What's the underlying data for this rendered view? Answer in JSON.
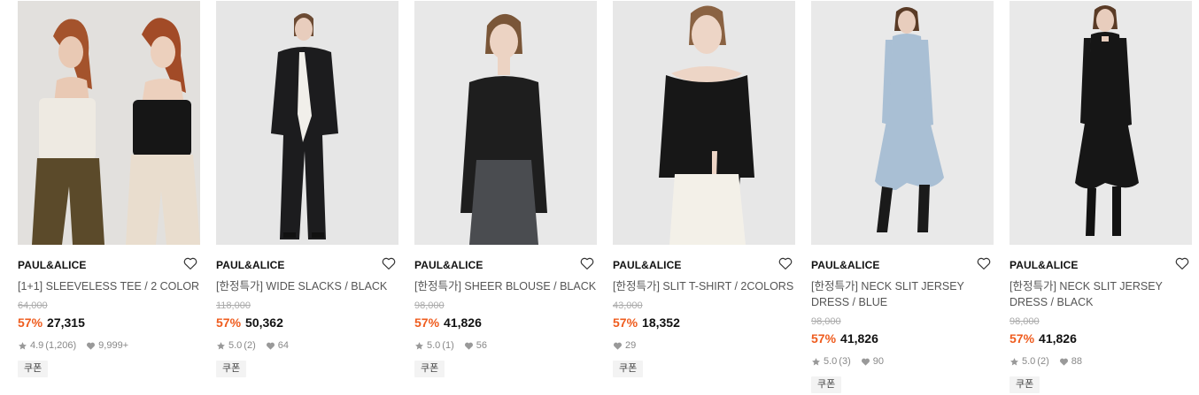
{
  "products": [
    {
      "brand": "PAUL&ALICE",
      "name": "[1+1] SLEEVELESS TEE / 2 COLOR",
      "original_price": "64,000",
      "discount": "57%",
      "price": "27,315",
      "rating": "4.9",
      "reviews": "(1,206)",
      "likes": "9,999+",
      "coupon": "쿠폰",
      "photo": "two-models-sleeveless-tees"
    },
    {
      "brand": "PAUL&ALICE",
      "name": "[한정특가] WIDE SLACKS / BLACK",
      "original_price": "118,000",
      "discount": "57%",
      "price": "50,362",
      "rating": "5.0",
      "reviews": "(2)",
      "likes": "64",
      "coupon": "쿠폰",
      "photo": "model-black-suit"
    },
    {
      "brand": "PAUL&ALICE",
      "name": "[한정특가] SHEER BLOUSE / BLACK",
      "original_price": "98,000",
      "discount": "57%",
      "price": "41,826",
      "rating": "5.0",
      "reviews": "(1)",
      "likes": "56",
      "coupon": "쿠폰",
      "photo": "model-black-blouse"
    },
    {
      "brand": "PAUL&ALICE",
      "name": "[한정특가] SLIT T-SHIRT / 2COLORS",
      "original_price": "43,000",
      "discount": "57%",
      "price": "18,352",
      "likes": "29",
      "coupon": "쿠폰",
      "photo": "model-black-slit-top"
    },
    {
      "brand": "PAUL&ALICE",
      "name": "[한정특가] NECK SLIT JERSEY DRESS / BLUE",
      "original_price": "98,000",
      "discount": "57%",
      "price": "41,826",
      "rating": "5.0",
      "reviews": "(3)",
      "likes": "90",
      "coupon": "쿠폰",
      "photo": "model-blue-dress"
    },
    {
      "brand": "PAUL&ALICE",
      "name": "[한정특가] NECK SLIT JERSEY DRESS / BLACK",
      "original_price": "98,000",
      "discount": "57%",
      "price": "41,826",
      "rating": "5.0",
      "reviews": "(2)",
      "likes": "88",
      "coupon": "쿠폰",
      "photo": "model-black-dress"
    }
  ],
  "colors": {
    "discount": "#ef5c1e",
    "photo_bg": "#e6e6e6"
  },
  "icons": {
    "wishlist": "heart-outline-icon",
    "rating": "star-icon",
    "likes": "heart-icon"
  }
}
